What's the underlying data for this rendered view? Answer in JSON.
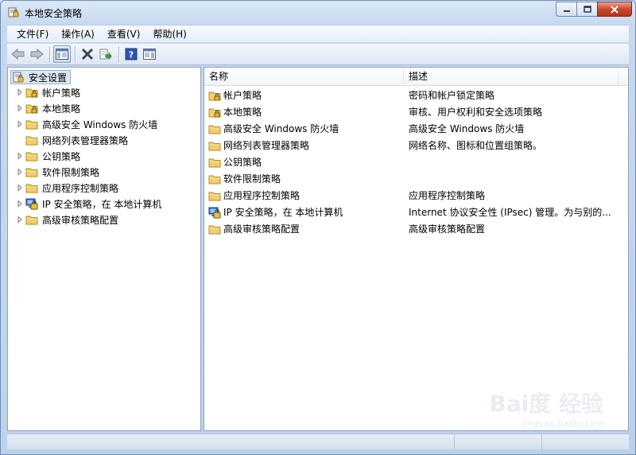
{
  "window": {
    "title": "本地安全策略"
  },
  "menu": [
    {
      "label": "文件(F)"
    },
    {
      "label": "操作(A)"
    },
    {
      "label": "查看(V)"
    },
    {
      "label": "帮助(H)"
    }
  ],
  "toolbar": {
    "buttons": [
      "back-arrow-icon",
      "forward-arrow-icon",
      "show-hide-console-tree-icon",
      "delete-icon",
      "export-list-icon",
      "help-icon",
      "properties-pane-icon"
    ]
  },
  "tree": {
    "root": {
      "label": "安全设置",
      "icon": "security-settings-icon"
    },
    "items": [
      {
        "label": "帐户策略",
        "icon": "locked-folder-icon",
        "expandable": true
      },
      {
        "label": "本地策略",
        "icon": "locked-folder-icon",
        "expandable": true
      },
      {
        "label": "高级安全 Windows 防火墙",
        "icon": "folder-icon",
        "expandable": true
      },
      {
        "label": "网络列表管理器策略",
        "icon": "folder-icon",
        "expandable": false
      },
      {
        "label": "公钥策略",
        "icon": "folder-icon",
        "expandable": true
      },
      {
        "label": "软件限制策略",
        "icon": "folder-icon",
        "expandable": true
      },
      {
        "label": "应用程序控制策略",
        "icon": "folder-icon",
        "expandable": true
      },
      {
        "label": "IP 安全策略，在 本地计算机",
        "icon": "ip-security-icon",
        "expandable": true
      },
      {
        "label": "高级审核策略配置",
        "icon": "folder-icon",
        "expandable": true
      }
    ]
  },
  "list": {
    "columns": {
      "name": "名称",
      "description": "描述"
    },
    "rows": [
      {
        "name": "帐户策略",
        "description": "密码和帐户锁定策略",
        "icon": "locked-folder-icon"
      },
      {
        "name": "本地策略",
        "description": "审核、用户权利和安全选项策略",
        "icon": "locked-folder-icon"
      },
      {
        "name": "高级安全 Windows 防火墙",
        "description": "高级安全 Windows 防火墙",
        "icon": "folder-icon"
      },
      {
        "name": "网络列表管理器策略",
        "description": "网络名称、图标和位置组策略。",
        "icon": "folder-icon"
      },
      {
        "name": "公钥策略",
        "description": "",
        "icon": "folder-icon"
      },
      {
        "name": "软件限制策略",
        "description": "",
        "icon": "folder-icon"
      },
      {
        "name": "应用程序控制策略",
        "description": "应用程序控制策略",
        "icon": "folder-icon"
      },
      {
        "name": "IP 安全策略，在 本地计算机",
        "description": "Internet 协议安全性 (IPsec) 管理。为与别的...",
        "icon": "ip-security-icon"
      },
      {
        "name": "高级审核策略配置",
        "description": "高级审核策略配置",
        "icon": "folder-icon"
      }
    ]
  },
  "watermark": {
    "text": "Bai度 经验",
    "sub": "jingyan.baidu.com"
  }
}
